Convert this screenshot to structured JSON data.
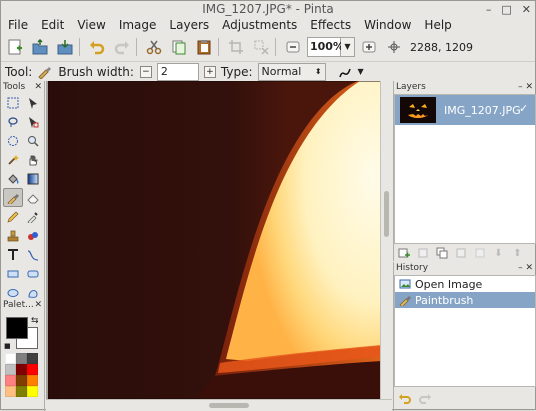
{
  "window": {
    "title": "IMG_1207.JPG* - Pinta",
    "controls": [
      "–",
      "□",
      "✕"
    ]
  },
  "menu": [
    "File",
    "Edit",
    "View",
    "Image",
    "Layers",
    "Adjustments",
    "Effects",
    "Window",
    "Help"
  ],
  "toolbar": {
    "zoom": "100%",
    "coordinates": "2288, 1209"
  },
  "tool_options": {
    "tool_label": "Tool:",
    "brush_width_label": "Brush width:",
    "brush_width_value": "2",
    "type_label": "Type:",
    "type_value": "Normal"
  },
  "tools_panel": {
    "title": "Tools"
  },
  "palette_panel": {
    "title": "Palet...",
    "colors": [
      "#ffffff",
      "#808080",
      "#404040",
      "#c0c0c0",
      "#7f0000",
      "#ff0000",
      "#ff8080",
      "#7f3f00",
      "#ff7f00",
      "#ffbf80",
      "#7f7f00",
      "#ffff00"
    ]
  },
  "layers_panel": {
    "title": "Layers",
    "layers": [
      {
        "name": "IMG_1207.JPG",
        "visible": true
      }
    ]
  },
  "history_panel": {
    "title": "History",
    "items": [
      {
        "label": "Open Image",
        "selected": false
      },
      {
        "label": "Paintbrush",
        "selected": true
      }
    ]
  },
  "colors": {
    "selection": "#86a5c6",
    "canvas_dark": "#2a0e0a",
    "canvas_bright": "#fff4c9",
    "canvas_edge": "#e8571a"
  }
}
